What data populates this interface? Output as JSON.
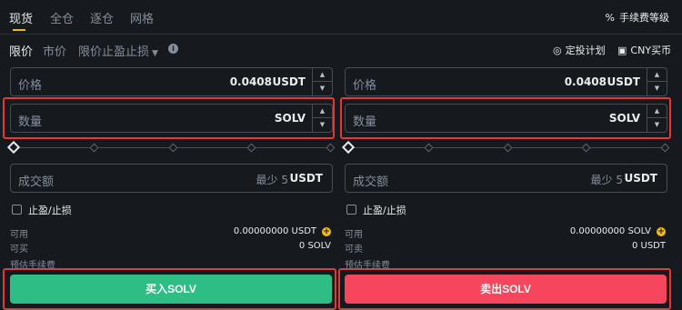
{
  "tabs": [
    "现货",
    "全仓",
    "逐仓",
    "网格"
  ],
  "fee_level": "手续费等级",
  "order_types": {
    "limit": "限价",
    "market": "市价",
    "stop_limit": "限价止盈止损"
  },
  "links": {
    "dca": "定投计划",
    "cny_buy": "CNY买币"
  },
  "buy": {
    "price_label": "价格",
    "price_value": "0.0408",
    "price_unit": "USDT",
    "qty_label": "数量",
    "qty_unit": "SOLV",
    "total_label": "成交额",
    "total_hint": "最少 5",
    "total_unit": "USDT",
    "tpsl_label": "止盈/止损",
    "available_label": "可用",
    "available_value": "0.00000000 USDT",
    "max_label": "可买",
    "max_value": "0 SOLV",
    "fee_label": "预估手续费",
    "button_label": "买入SOLV"
  },
  "sell": {
    "price_label": "价格",
    "price_value": "0.0408",
    "price_unit": "USDT",
    "qty_label": "数量",
    "qty_unit": "SOLV",
    "total_label": "成交额",
    "total_hint": "最少 5",
    "total_unit": "USDT",
    "tpsl_label": "止盈/止损",
    "available_label": "可用",
    "available_value": "0.00000000 SOLV",
    "max_label": "可卖",
    "max_value": "0 USDT",
    "fee_label": "预估手续费",
    "button_label": "卖出SOLV"
  },
  "colors": {
    "buy": "#2ebd85",
    "sell": "#f6465d",
    "accent": "#f0b90b",
    "highlight": "#e53935"
  }
}
